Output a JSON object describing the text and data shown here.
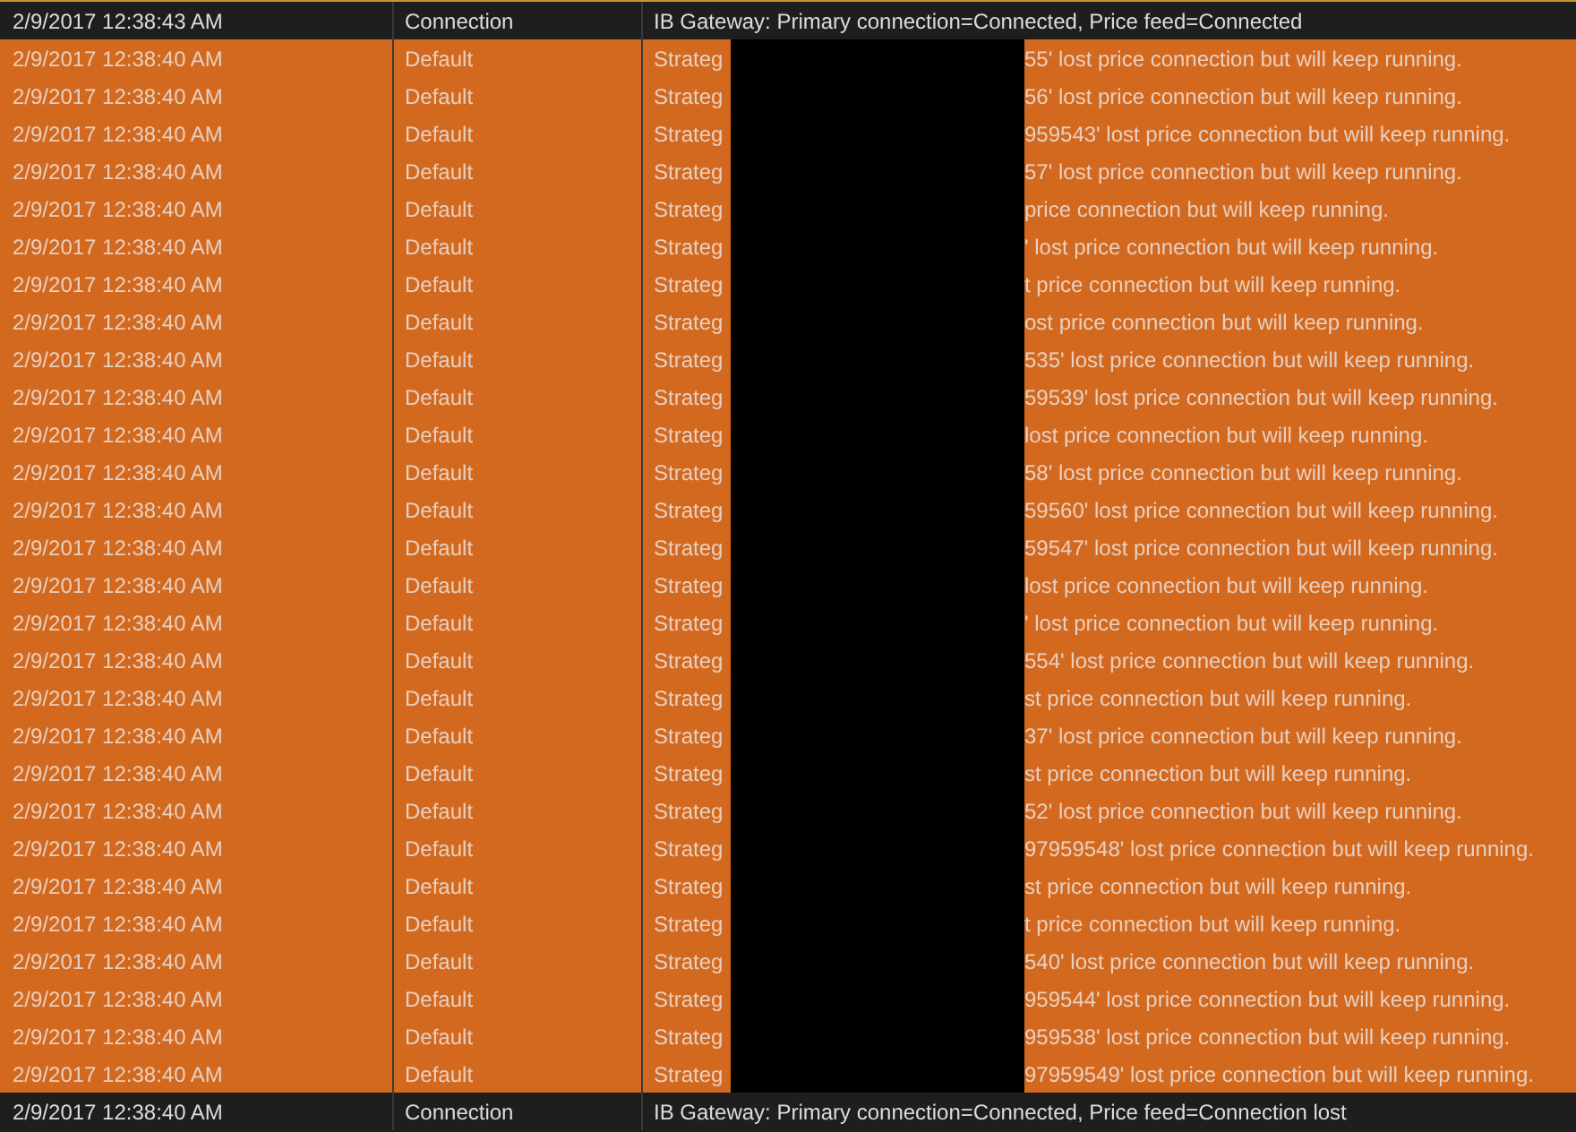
{
  "log_rows": [
    {
      "kind": "connection",
      "time": "2/9/2017 12:38:43 AM",
      "category": "Connection",
      "message": "IB Gateway: Primary connection=Connected, Price feed=Connected"
    },
    {
      "kind": "strategy",
      "time": "2/9/2017 12:38:40 AM",
      "category": "Default",
      "lead": "Strateg",
      "tail": "55' lost price connection but will keep running."
    },
    {
      "kind": "strategy",
      "time": "2/9/2017 12:38:40 AM",
      "category": "Default",
      "lead": "Strateg",
      "tail": "56' lost price connection but will keep running."
    },
    {
      "kind": "strategy",
      "time": "2/9/2017 12:38:40 AM",
      "category": "Default",
      "lead": "Strateg",
      "tail": "959543' lost price connection but will keep running."
    },
    {
      "kind": "strategy",
      "time": "2/9/2017 12:38:40 AM",
      "category": "Default",
      "lead": "Strateg",
      "tail": "57' lost price connection but will keep running."
    },
    {
      "kind": "strategy",
      "time": "2/9/2017 12:38:40 AM",
      "category": "Default",
      "lead": "Strateg",
      "tail": "price connection but will keep running."
    },
    {
      "kind": "strategy",
      "time": "2/9/2017 12:38:40 AM",
      "category": "Default",
      "lead": "Strateg",
      "tail": "' lost price connection but will keep running."
    },
    {
      "kind": "strategy",
      "time": "2/9/2017 12:38:40 AM",
      "category": "Default",
      "lead": "Strateg",
      "tail": "t price connection but will keep running."
    },
    {
      "kind": "strategy",
      "time": "2/9/2017 12:38:40 AM",
      "category": "Default",
      "lead": "Strateg",
      "tail": "ost price connection but will keep running."
    },
    {
      "kind": "strategy",
      "time": "2/9/2017 12:38:40 AM",
      "category": "Default",
      "lead": "Strateg",
      "tail": "535' lost price connection but will keep running."
    },
    {
      "kind": "strategy",
      "time": "2/9/2017 12:38:40 AM",
      "category": "Default",
      "lead": "Strateg",
      "tail": "59539' lost price connection but will keep running."
    },
    {
      "kind": "strategy",
      "time": "2/9/2017 12:38:40 AM",
      "category": "Default",
      "lead": "Strateg",
      "tail": "lost price connection but will keep running."
    },
    {
      "kind": "strategy",
      "time": "2/9/2017 12:38:40 AM",
      "category": "Default",
      "lead": "Strateg",
      "tail": "58' lost price connection but will keep running."
    },
    {
      "kind": "strategy",
      "time": "2/9/2017 12:38:40 AM",
      "category": "Default",
      "lead": "Strateg",
      "tail": "59560' lost price connection but will keep running."
    },
    {
      "kind": "strategy",
      "time": "2/9/2017 12:38:40 AM",
      "category": "Default",
      "lead": "Strateg",
      "tail": "59547' lost price connection but will keep running."
    },
    {
      "kind": "strategy",
      "time": "2/9/2017 12:38:40 AM",
      "category": "Default",
      "lead": "Strateg",
      "tail": "lost price connection but will keep running."
    },
    {
      "kind": "strategy",
      "time": "2/9/2017 12:38:40 AM",
      "category": "Default",
      "lead": "Strateg",
      "tail": "' lost price connection but will keep running."
    },
    {
      "kind": "strategy",
      "time": "2/9/2017 12:38:40 AM",
      "category": "Default",
      "lead": "Strateg",
      "tail": "554' lost price connection but will keep running."
    },
    {
      "kind": "strategy",
      "time": "2/9/2017 12:38:40 AM",
      "category": "Default",
      "lead": "Strateg",
      "tail": "st price connection but will keep running."
    },
    {
      "kind": "strategy",
      "time": "2/9/2017 12:38:40 AM",
      "category": "Default",
      "lead": "Strateg",
      "tail": "37' lost price connection but will keep running."
    },
    {
      "kind": "strategy",
      "time": "2/9/2017 12:38:40 AM",
      "category": "Default",
      "lead": "Strateg",
      "tail": "st price connection but will keep running."
    },
    {
      "kind": "strategy",
      "time": "2/9/2017 12:38:40 AM",
      "category": "Default",
      "lead": "Strateg",
      "tail": "52' lost price connection but will keep running."
    },
    {
      "kind": "strategy",
      "time": "2/9/2017 12:38:40 AM",
      "category": "Default",
      "lead": "Strateg",
      "tail": "97959548' lost price connection but will keep running."
    },
    {
      "kind": "strategy",
      "time": "2/9/2017 12:38:40 AM",
      "category": "Default",
      "lead": "Strateg",
      "tail": "st price connection but will keep running."
    },
    {
      "kind": "strategy",
      "time": "2/9/2017 12:38:40 AM",
      "category": "Default",
      "lead": "Strateg",
      "tail": "t price connection but will keep running."
    },
    {
      "kind": "strategy",
      "time": "2/9/2017 12:38:40 AM",
      "category": "Default",
      "lead": "Strateg",
      "tail": "540' lost price connection but will keep running."
    },
    {
      "kind": "strategy",
      "time": "2/9/2017 12:38:40 AM",
      "category": "Default",
      "lead": "Strateg",
      "tail": "959544' lost price connection but will keep running."
    },
    {
      "kind": "strategy",
      "time": "2/9/2017 12:38:40 AM",
      "category": "Default",
      "lead": "Strateg",
      "tail": "959538' lost price connection but will keep running."
    },
    {
      "kind": "strategy",
      "time": "2/9/2017 12:38:40 AM",
      "category": "Default",
      "lead": "Strateg",
      "tail": "97959549' lost price connection but will keep running."
    },
    {
      "kind": "connection",
      "time": "2/9/2017 12:38:40 AM",
      "category": "Connection",
      "message": "IB Gateway: Primary connection=Connected, Price feed=Connection lost"
    }
  ]
}
